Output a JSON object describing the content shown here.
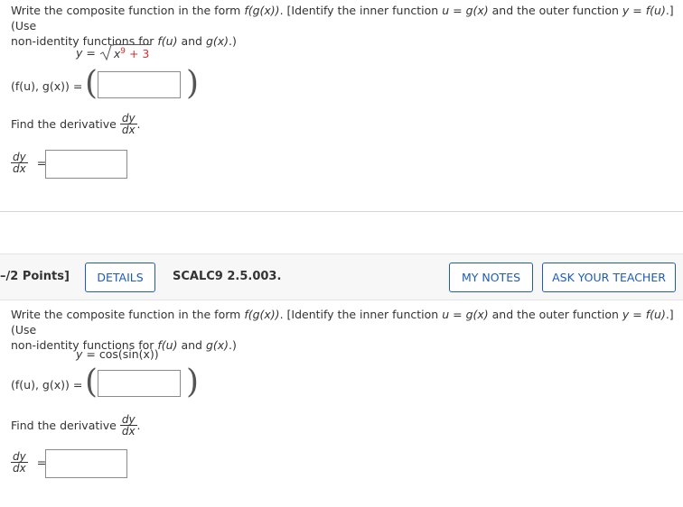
{
  "q1": {
    "prompt_prefix": "Write the composite function in the form ",
    "prompt_fgx": "f(g(x))",
    "prompt_mid1": ". [Identify the inner function ",
    "prompt_u": "u",
    "prompt_eq1": " = ",
    "prompt_gx": "g(x)",
    "prompt_mid2": " and the outer function ",
    "prompt_y": "y",
    "prompt_eq2": " = ",
    "prompt_fu": "f(u)",
    "prompt_end": ".] (Use",
    "prompt_line2_a": "non-identity functions for ",
    "prompt_line2_fu": "f(u)",
    "prompt_line2_and": " and ",
    "prompt_line2_gx": "g(x)",
    "prompt_line2_end": ".)",
    "eq_y": "y",
    "eq_equals": " = ",
    "eq_x": "x",
    "eq_exp": "9",
    "eq_plus": " + 3",
    "pair_label": "(f(u), g(x)) =",
    "find_derivative": "Find the derivative",
    "dy": "dy",
    "dx": "dx",
    "period": ".",
    "equals": "="
  },
  "header": {
    "points": "–/2 Points]",
    "details_button": "DETAILS",
    "problem_id": "SCALC9 2.5.003.",
    "my_notes_button": "MY NOTES",
    "ask_teacher_button": "ASK YOUR TEACHER"
  },
  "q2": {
    "prompt_prefix": "Write the composite function in the form ",
    "prompt_fgx": "f(g(x))",
    "prompt_mid1": ". [Identify the inner function ",
    "prompt_u": "u",
    "prompt_eq1": " = ",
    "prompt_gx": "g(x)",
    "prompt_mid2": " and the outer function ",
    "prompt_y": "y",
    "prompt_eq2": " = ",
    "prompt_fu": "f(u)",
    "prompt_end": ".] (Use",
    "prompt_line2_a": "non-identity functions for ",
    "prompt_line2_fu": "f(u)",
    "prompt_line2_and": " and ",
    "prompt_line2_gx": "g(x)",
    "prompt_line2_end": ".)",
    "eq_y": "y",
    "eq_rest": " = cos(sin(x))",
    "pair_label": "(f(u), g(x)) =",
    "find_derivative": "Find the derivative",
    "dy": "dy",
    "dx": "dx",
    "period": ".",
    "equals": "="
  },
  "colors": {
    "accent": "#1e5bb8",
    "red_text": "#d32f2f"
  }
}
